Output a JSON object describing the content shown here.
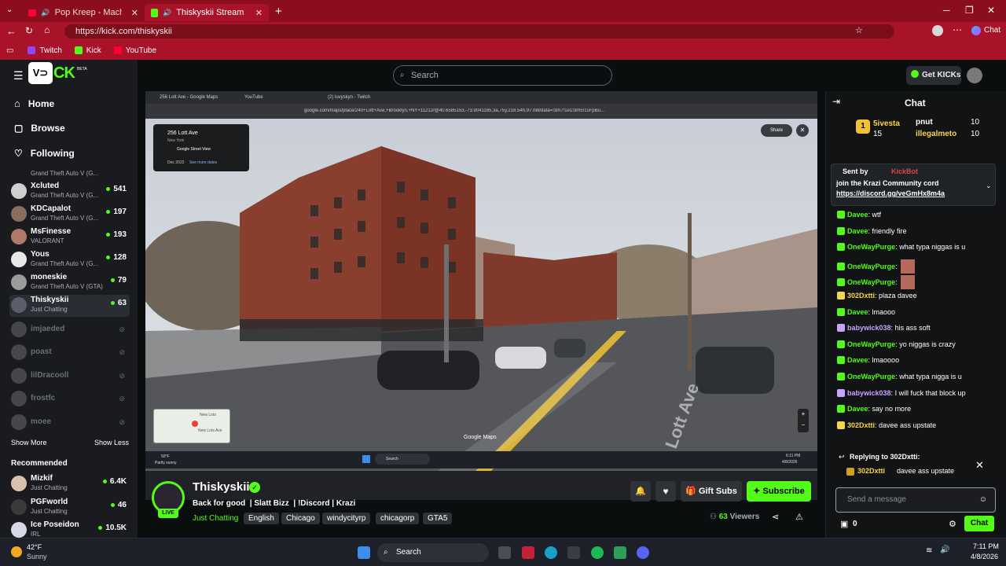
{
  "browser": {
    "tabs": [
      {
        "title": "Pop Kreep - Macho Man (Mc"
      },
      {
        "title": "Thiskyskii Stream - Watch Liv"
      }
    ],
    "url": "https://kick.com/thiskyskii",
    "bookmarks": [
      "Twitch",
      "Kick",
      "YouTube"
    ]
  },
  "brand": {
    "beta": "BETA"
  },
  "header": {
    "search_placeholder": "Search",
    "get_kicks": "Get KICKs"
  },
  "nav": {
    "home": "Home",
    "browse": "Browse",
    "following": "Following",
    "show_more": "Show More",
    "show_less": "Show Less",
    "recommended": "Recommended"
  },
  "following": [
    {
      "name": "",
      "game": "Grand Theft Auto V (G...",
      "viewers": ""
    },
    {
      "name": "Xcluted",
      "game": "Grand Theft Auto V (G...",
      "viewers": "541"
    },
    {
      "name": "KDCapalot",
      "game": "Grand Theft Auto V (G...",
      "viewers": "197"
    },
    {
      "name": "MsFinesse",
      "game": "VALORANT",
      "viewers": "193"
    },
    {
      "name": "Yous",
      "game": "Grand Theft Auto V (G...",
      "viewers": "128"
    },
    {
      "name": "moneskie",
      "game": "Grand Theft Auto V (GTA)",
      "viewers": "79"
    },
    {
      "name": "Thiskyskii",
      "game": "Just Chatting",
      "viewers": "63"
    }
  ],
  "offline": [
    "imjaeded",
    "poast",
    "lilDracooll",
    "frostfc",
    "moee"
  ],
  "recommended": [
    {
      "name": "Mizkif",
      "game": "Just Chatting",
      "viewers": "6.4K"
    },
    {
      "name": "PGFworld",
      "game": "Just Chatting",
      "viewers": "46"
    },
    {
      "name": "Ice Poseidon",
      "game": "IRL",
      "viewers": "10.5K"
    }
  ],
  "video": {
    "inner_tabs": [
      "256 Lott Ave - Google Maps",
      "YouTube",
      "(2) luvyskyn - Twitch"
    ],
    "inner_url": "google.com/maps/place/240+Lott+Ave,+Brooklyn,+NY+11212/@40.6585153,-73.9041185,3a,75y,218.54h,97.08t/data=!3m7!1e1!3m5!1sFpBu...",
    "place_title": "256 Lott Ave",
    "place_sub": "New York",
    "place_mode": "Google Street View",
    "place_date": "Dec 2022",
    "place_more": "See more dates",
    "share": "Share",
    "street_sign": "Lott Ave",
    "google_maps": "Google Maps",
    "map_labels": [
      "New Lots",
      "New Lots Ave"
    ],
    "weather": "50°F",
    "weather_sub": "Partly sunny",
    "inner_search": "Search",
    "inner_time": "6:11 PM",
    "inner_date": "4/8/2026"
  },
  "stream": {
    "channel": "Thiskyskii",
    "live": "LIVE",
    "title": "Back for good  | Slatt Bizz  | !Discord | Krazi",
    "category": "Just Chatting",
    "tags": [
      "English",
      "Chicago",
      "windycityrp",
      "chicagorp",
      "GTA5"
    ],
    "viewers": "63",
    "viewers_label": "Viewers",
    "gift_subs": "Gift Subs",
    "subscribe": "Subscribe"
  },
  "chat": {
    "title": "Chat",
    "leaders": [
      {
        "rank": "1",
        "name": "5ivesta",
        "score": "15"
      },
      {
        "name": "pnut",
        "score": "10"
      },
      {
        "name": "illegalmeto",
        "score": "10"
      }
    ],
    "pinned_sent_by": "Sent by",
    "pinned_user": "KickBot",
    "pinned_text": "join the Krazi Community cord",
    "pinned_link": "https://discord.gg/veGmHx8m4a",
    "messages": [
      {
        "user": "Davee",
        "text": "wtf",
        "color": "#53fc18"
      },
      {
        "user": "Davee",
        "text": "friendly fire",
        "color": "#53fc18"
      },
      {
        "user": "OneWayPurge",
        "text": "what typa niggas is u",
        "color": "#53fc18"
      },
      {
        "user": "OneWayPurge",
        "text": "",
        "color": "#53fc18"
      },
      {
        "user": "OneWayPurge",
        "text": "",
        "color": "#53fc18"
      },
      {
        "user": "302Dxtti",
        "text": "plaza davee",
        "color": "#f7d54a"
      },
      {
        "user": "Davee",
        "text": "lmaooo",
        "color": "#53fc18"
      },
      {
        "user": "babywick038",
        "text": "his ass soft",
        "color": "#c7a2ff"
      },
      {
        "user": "OneWayPurge",
        "text": "yo niggas is crazy",
        "color": "#53fc18"
      },
      {
        "user": "Davee",
        "text": "lmaoooo",
        "color": "#53fc18"
      },
      {
        "user": "OneWayPurge",
        "text": "what typa nigga is u",
        "color": "#53fc18"
      },
      {
        "user": "babywick038",
        "text": "I will fuck that block up",
        "color": "#c7a2ff"
      },
      {
        "user": "Davee",
        "text": "say no more",
        "color": "#53fc18"
      },
      {
        "user": "302Dxtti",
        "text": "davee ass upstate",
        "color": "#f7d54a"
      }
    ],
    "replying_to": "Replying to 302Dxtti:",
    "reply_user": "302Dxtti",
    "reply_text": "davee ass upstate",
    "placeholder": "Send a message",
    "kicks": "0",
    "send": "Chat"
  },
  "taskbar": {
    "temp": "42°F",
    "weather": "Sunny",
    "search": "Search",
    "time": "7:11 PM",
    "date": "4/8/2026"
  }
}
